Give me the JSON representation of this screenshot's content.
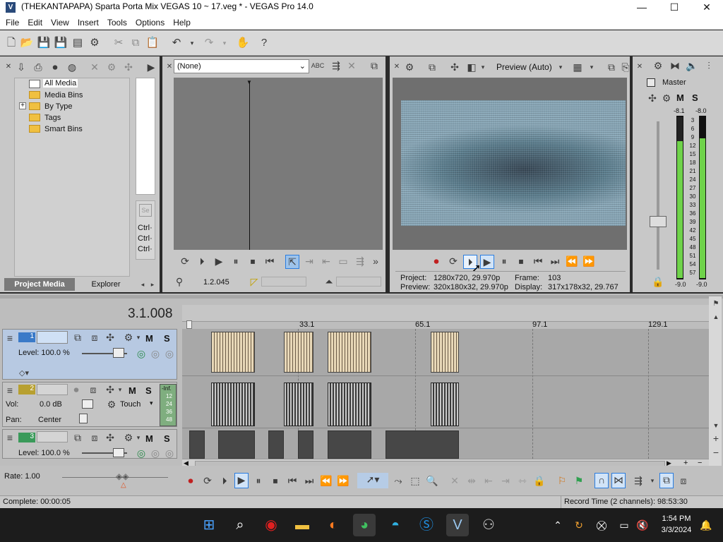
{
  "window": {
    "title": "(THEKANTAPAPA) Sparta Porta Mix VEGAS 10 ~ 17.veg * - VEGAS Pro 14.0",
    "min": "—",
    "max": "☐",
    "close": "✕"
  },
  "menu": [
    "File",
    "Edit",
    "View",
    "Insert",
    "Tools",
    "Options",
    "Help"
  ],
  "media": {
    "tree": [
      "All Media",
      "Media Bins",
      "By Type",
      "Tags",
      "Smart Bins"
    ],
    "expand": "+",
    "tabs": [
      "Project Media",
      "Explorer"
    ],
    "shortcuts": [
      "Ctrl·",
      "Ctrl·",
      "Ctrl·"
    ]
  },
  "trimmer": {
    "select": "(None)",
    "time": "1.2.045"
  },
  "preview": {
    "mode": "Preview (Auto)",
    "project_label": "Project:",
    "project_value": "1280x720, 29.970p",
    "preview_label": "Preview:",
    "preview_value": "320x180x32, 29.970p",
    "frame_label": "Frame:",
    "frame_value": "103",
    "display_label": "Display:",
    "display_value": "317x178x32, 29.767"
  },
  "master": {
    "title": "Master",
    "m": "M",
    "s": "S",
    "peak_l": "-8.1",
    "peak_r": "-8.0",
    "scale": [
      "3",
      "6",
      "9",
      "12",
      "15",
      "18",
      "21",
      "24",
      "27",
      "30",
      "33",
      "36",
      "39",
      "42",
      "45",
      "48",
      "51",
      "54",
      "57"
    ],
    "bottom_l": "-9.0",
    "bottom_r": "-9.0"
  },
  "timeline": {
    "cursor": "3.1.008",
    "markers": [
      "33.1",
      "65.1",
      "97.1",
      "129.1"
    ],
    "rate": "Rate: 1.00"
  },
  "tracks": [
    {
      "num": "1",
      "level": "Level: 100.0 %",
      "m": "M",
      "s": "S"
    },
    {
      "num": "2",
      "vol": "Vol:",
      "vol_value": "0.0 dB",
      "pan": "Pan:",
      "pan_value": "Center",
      "mode": "Touch",
      "m": "M",
      "s": "S",
      "meter": [
        "-Inf.",
        "12",
        "24",
        "36",
        "48"
      ]
    },
    {
      "num": "3",
      "level": "Level: 100.0 %",
      "m": "M",
      "s": "S"
    }
  ],
  "status": {
    "complete": "Complete: 00:00:05",
    "record": "Record Time (2 channels): 98:53:30"
  },
  "clock": {
    "time": "1:54 PM",
    "date": "3/3/2024"
  },
  "colors": {
    "accent": "#2a7de0",
    "panel": "#c8c8c8",
    "track_sel": "#b7c9e2",
    "meter": "#6fd34a"
  }
}
